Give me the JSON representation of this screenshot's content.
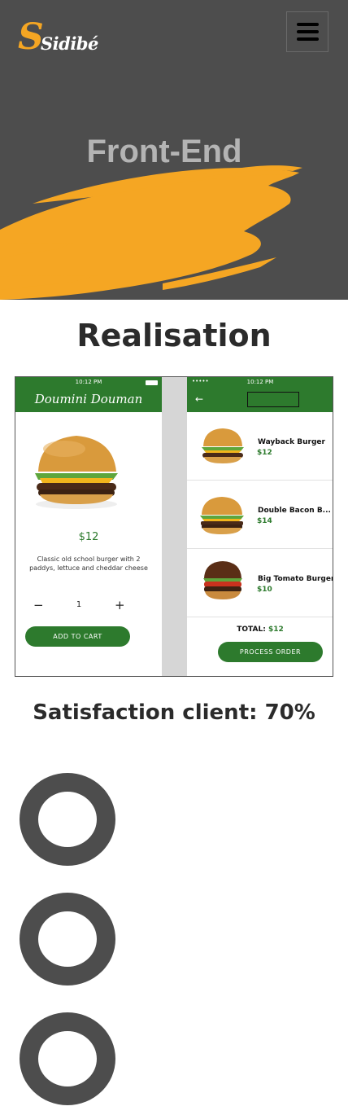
{
  "header": {
    "logo_initial": "S",
    "logo_text": "Sidibé",
    "menu_icon": "hamburger-icon",
    "title": "Front-End",
    "brush_color": "#f5a623",
    "background_color": "#4d4d4d"
  },
  "realisation": {
    "title": "Realisation",
    "left_phone": {
      "time": "10:12 PM",
      "brand": "Doumini Douman",
      "price": "$12",
      "description": "Classic old school burger with 2 paddys, lettuce and cheddar cheese",
      "minus": "−",
      "quantity": "1",
      "plus": "+",
      "cart_button": "ADD TO CART"
    },
    "right_phone": {
      "signal": "•••••",
      "time": "10:12 PM",
      "back": "←",
      "items": [
        {
          "name": "Wayback Burger",
          "price": "$12"
        },
        {
          "name": "Double Bacon B...",
          "price": "$14"
        },
        {
          "name": "Big Tomato Burger",
          "price": "$10"
        }
      ],
      "total_label": "TOTAL: ",
      "total_value": "$12",
      "order_button": "PROCESS ORDER"
    },
    "accent_color": "#2d7a2d"
  },
  "satisfaction": {
    "label": "Satisfaction client: 70%",
    "value_percent": 70,
    "ring_count": 3
  }
}
